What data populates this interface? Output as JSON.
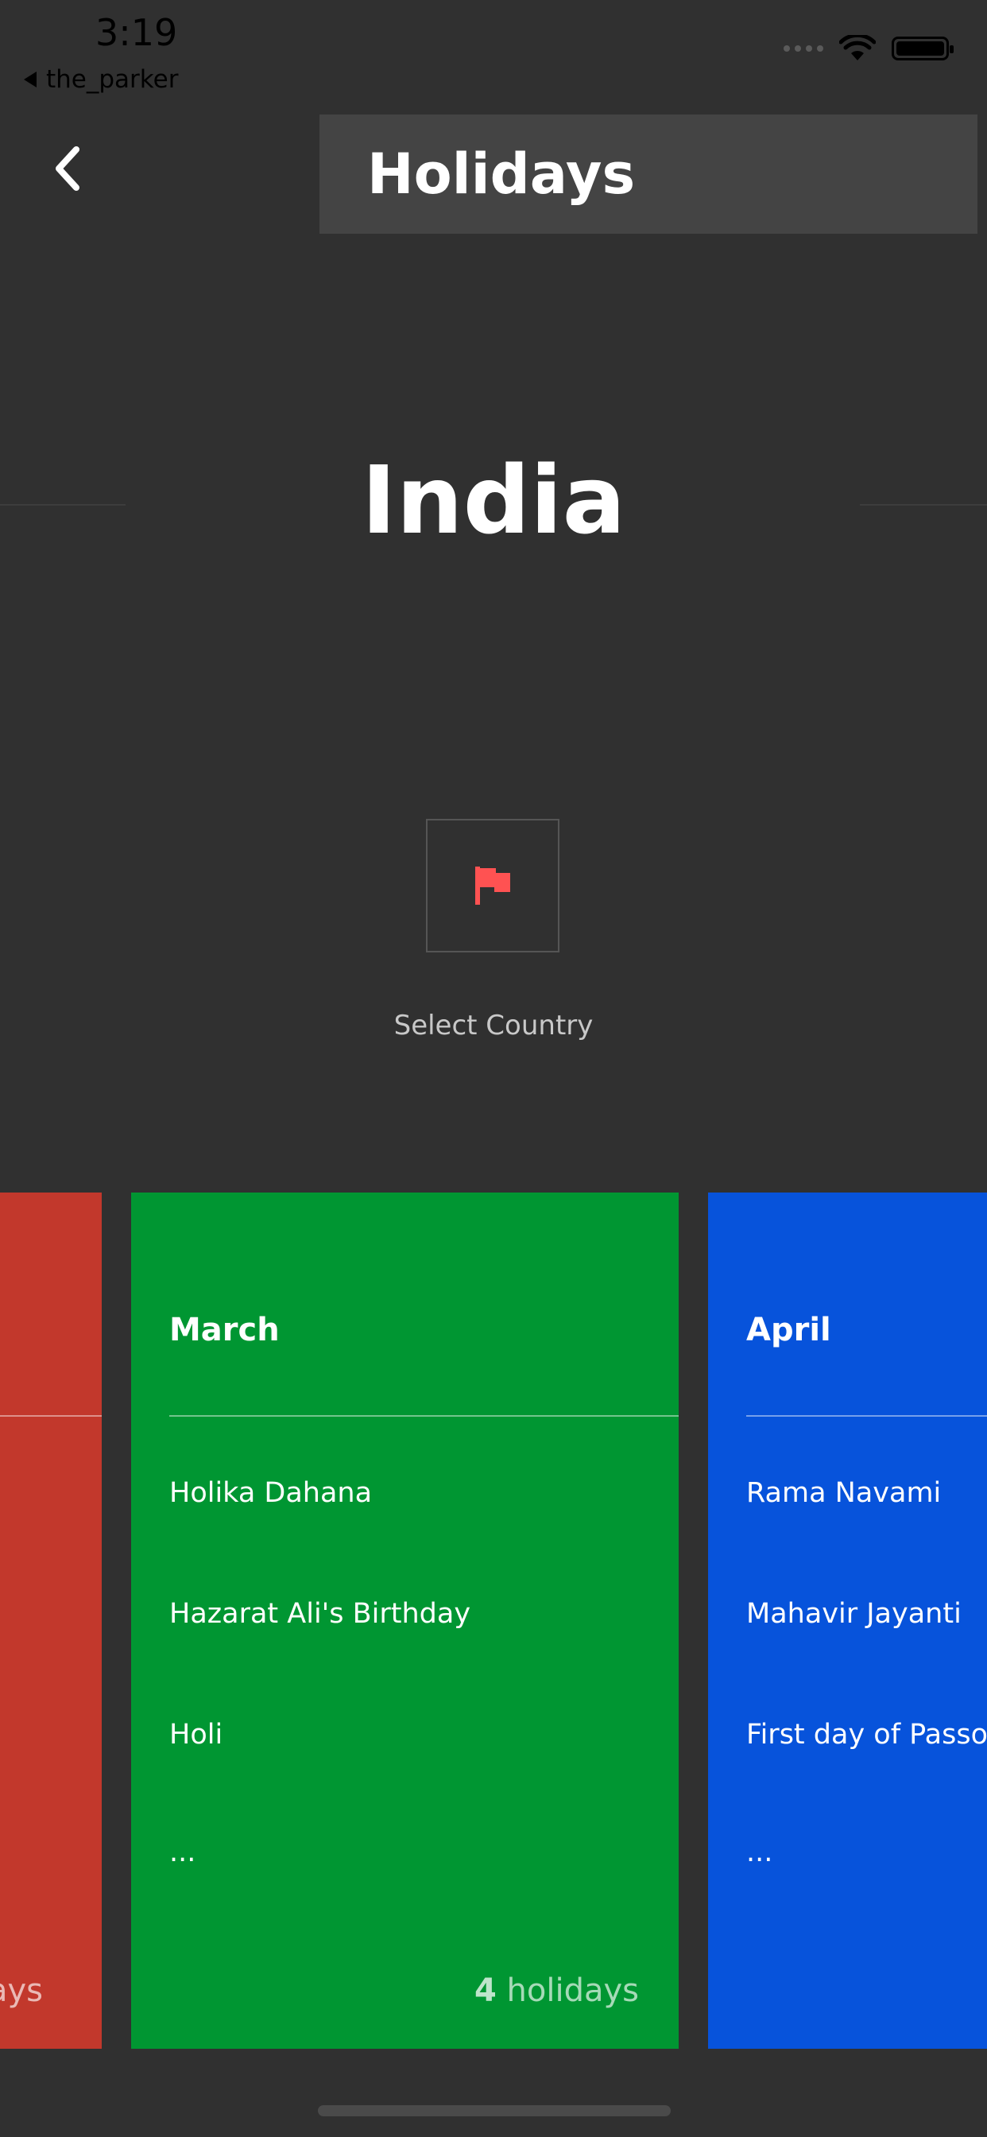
{
  "status_bar": {
    "time": "3:19",
    "back_app": "the_parker"
  },
  "header": {
    "title": "Holidays"
  },
  "country": {
    "name": "India"
  },
  "selector": {
    "label": "Select Country"
  },
  "cards": [
    {
      "color": "#c2382c",
      "footer_label": "days"
    },
    {
      "month": "March",
      "color": "#009632",
      "items": [
        "Holika Dahana",
        "Hazarat Ali's Birthday",
        "Holi"
      ],
      "ellipsis": "...",
      "count": "4",
      "count_label": "holidays"
    },
    {
      "month": "April",
      "color": "#0753db",
      "items": [
        "Rama Navami",
        "Mahavir Jayanti",
        "First day of Passover"
      ],
      "ellipsis": "..."
    }
  ],
  "icons": {
    "back": "chevron-left-icon",
    "flag": "flag-icon",
    "wifi": "wifi-icon",
    "battery": "battery-icon"
  },
  "colors": {
    "background": "#303030",
    "header_box": "#444444",
    "flag": "#ff5252"
  }
}
